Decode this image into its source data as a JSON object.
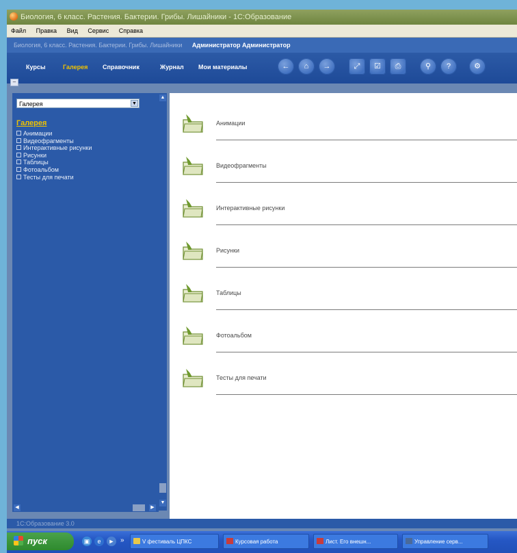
{
  "window": {
    "title": "Биология, 6 класс. Растения. Бактерии. Грибы. Лишайники - 1С:Образование",
    "menu": [
      "Файл",
      "Правка",
      "Вид",
      "Сервис",
      "Справка"
    ],
    "info_path": "Биология, 6 класс. Растения. Бактерии. Грибы. Лишайники",
    "user": "Администратор Администратор"
  },
  "nav": {
    "tabs": [
      {
        "label": "Курсы",
        "active": false
      },
      {
        "label": "Галерея",
        "active": true
      },
      {
        "label": "Справочник",
        "active": false
      },
      {
        "label": "Журнал",
        "active": false
      },
      {
        "label": "Мои материалы",
        "active": false
      }
    ],
    "buttons": [
      "back-icon",
      "home-icon",
      "forward-icon",
      "fullscreen-icon",
      "bookmark-icon",
      "print-icon",
      "search-icon",
      "help-icon",
      "settings-icon"
    ]
  },
  "sidebar": {
    "dropdown_value": "Галерея",
    "tree_title": "Галерея",
    "tree_items": [
      "Анимации",
      "Видеофрагменты",
      "Интерактивные рисунки",
      "Рисунки",
      "Таблицы",
      "Фотоальбом",
      "Тесты для печати"
    ]
  },
  "content": {
    "items": [
      "Анимации",
      "Видеофрагменты",
      "Интерактивные рисунки",
      "Рисунки",
      "Таблицы",
      "Фотоальбом",
      "Тесты для печати"
    ]
  },
  "footer": {
    "text": "1С:Образование 3.0"
  },
  "taskbar": {
    "start_label": "пуск",
    "tasks": [
      "V фестиваль ЦПКС",
      "Курсовая работа",
      "Лист. Его внешн...",
      "Управление серв..."
    ]
  },
  "colors": {
    "accent": "#f0c200",
    "panel": "#2b5aa8",
    "toolbar": "#1e4a98",
    "folder": "#7a9a3a"
  }
}
